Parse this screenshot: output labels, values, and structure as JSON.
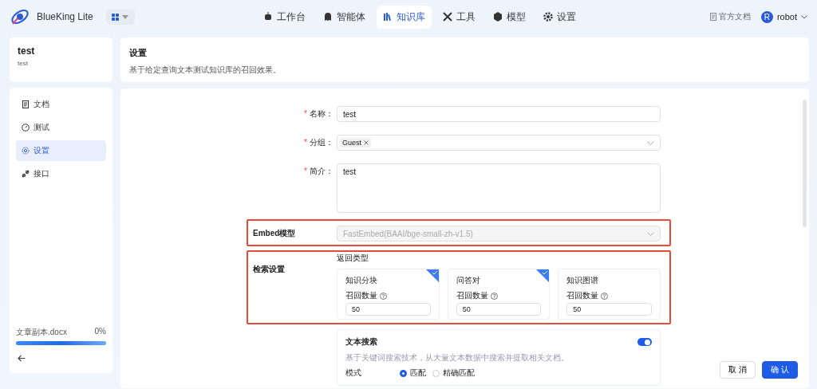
{
  "app": {
    "name": "BlueKing Lite"
  },
  "nav": [
    {
      "label": "工作台",
      "kind": "robot",
      "selected": false
    },
    {
      "label": "智能体",
      "kind": "ghost",
      "selected": false
    },
    {
      "label": "知识库",
      "kind": "books",
      "selected": true
    },
    {
      "label": "工具",
      "kind": "tools",
      "selected": false
    },
    {
      "label": "模型",
      "kind": "cube",
      "selected": false
    },
    {
      "label": "设置",
      "kind": "gear",
      "selected": false
    }
  ],
  "header_right": {
    "docs_link": "官方文档",
    "avatar": "R",
    "user": "robot"
  },
  "kb": {
    "title": "test",
    "subtitle": "test"
  },
  "sidebar": {
    "items": [
      {
        "label": "文档",
        "kind": "doc",
        "selected": false
      },
      {
        "label": "测试",
        "kind": "gauge",
        "selected": false
      },
      {
        "label": "设置",
        "kind": "gear",
        "selected": true
      },
      {
        "label": "接口",
        "kind": "link",
        "selected": false
      }
    ],
    "upload": {
      "file": "文章副本.docx",
      "percent": "0%",
      "level": 1
    }
  },
  "page": {
    "title": "设置",
    "description": "基于给定查询文本测试知识库的召回效果。"
  },
  "form": {
    "name": {
      "label": "名称：",
      "required_mark": "*",
      "value": "test"
    },
    "group": {
      "label": "分组：",
      "required_mark": "*",
      "tags": [
        "Guest"
      ]
    },
    "intro": {
      "label": "简介：",
      "required_mark": "*",
      "value": "test"
    },
    "embed": {
      "label": "Embed模型",
      "value": "FastEmbed(BAAI/bge-small-zh-v1.5)",
      "disabled": true
    },
    "retrieval": {
      "label": "检索设置",
      "return_type_label": "返回类型",
      "types": [
        {
          "title": "知识分块",
          "selected": true,
          "count_label": "召回数量",
          "count": "50"
        },
        {
          "title": "问答对",
          "selected": true,
          "count_label": "召回数量",
          "count": "50"
        },
        {
          "title": "知识图谱",
          "selected": false,
          "count_label": "召回数量",
          "count": "50"
        }
      ]
    },
    "text_search": {
      "title": "文本搜索",
      "on": true,
      "description": "基于关键词搜索技术，从大量文本数据中搜索并提取相关文档。",
      "mode_label": "模式",
      "modes": [
        {
          "label": "匹配",
          "selected": true
        },
        {
          "label": "精确匹配",
          "selected": false
        }
      ]
    }
  },
  "buttons": {
    "cancel": "取 消",
    "confirm": "确 认"
  }
}
